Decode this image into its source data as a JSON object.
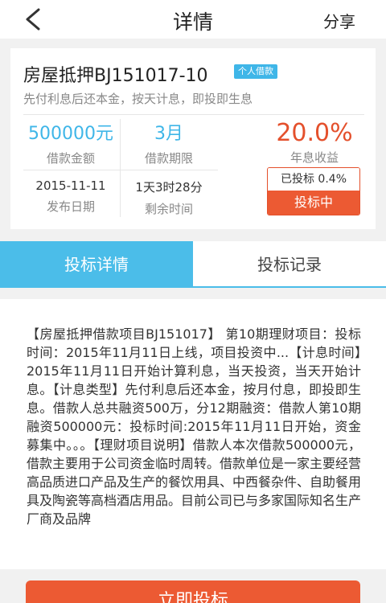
{
  "nav": {
    "title": "详情",
    "share": "分享"
  },
  "card": {
    "name": "房屋抵押BJ151017-10",
    "badge": "个人借款",
    "desc": "先付利息后还本金，按天计息，即投即生息",
    "amount": {
      "value": "500000元",
      "label": "借款金额"
    },
    "term": {
      "value": "3月",
      "label": "借款期限"
    },
    "publish": {
      "value": "2015-11-11",
      "label": "发布日期"
    },
    "remain": {
      "value": "1天3时28分",
      "label": "剩余时间"
    },
    "rate": {
      "value": "20.0%",
      "label": "年息收益"
    },
    "progress": {
      "text": "已投标 0.4%",
      "value_percent": 0.4,
      "status": "投标中"
    }
  },
  "tabs": {
    "detail": "投标详情",
    "records": "投标记录"
  },
  "content": {
    "text": "【房屋抵押借款项目BJ151017】 第10期理财项目：投标时间：2015年11月11日上线，项目投资中...【计息时间】2015年11月11日开始计算利息，当天投资，当天开始计息。【计息类型】先付利息后还本金，按月付息，即投即生息。借款人总共融资500万，分12期融资：借款人第10期融资500000元：投标时间:2015年11月11日开始，资金募集中。。。【理财项目说明】借款人本次借款500000元，借款主要用于公司资金临时周转。借款单位是一家主要经营高品质进口产品及生产的餐饮用具、中西餐杂件、自助餐用具及陶瓷等高档酒店用品。目前公司已与多家国际知名生产厂商及品牌"
  },
  "footer": {
    "invest": "立即投标"
  },
  "colors": {
    "accent": "#4bbde9",
    "rate": "#e4502c",
    "button": "#ec5a33"
  },
  "icons": {
    "back": "chevron-left-icon"
  }
}
